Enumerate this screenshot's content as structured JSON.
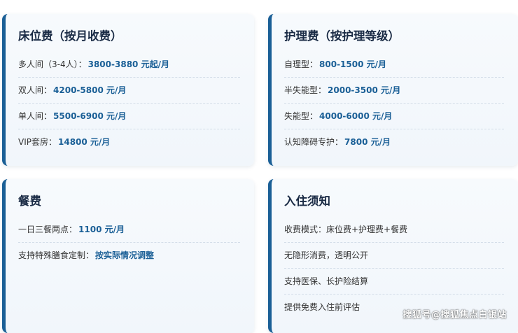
{
  "colors": {
    "accent": "#1a5f96",
    "title": "#1a2b45",
    "text": "#333333",
    "card_bg": "#f4f8fc"
  },
  "cards": [
    {
      "title": "床位费（按月收费）",
      "rows": [
        {
          "label": "多人间（3-4人）：",
          "value": "3800-3880 元起/月"
        },
        {
          "label": "双人间：",
          "value": "4200-5800 元/月"
        },
        {
          "label": "单人间：",
          "value": "5500-6900 元/月"
        },
        {
          "label": "VIP套房：",
          "value": "14800 元/月"
        }
      ]
    },
    {
      "title": "护理费（按护理等级）",
      "rows": [
        {
          "label": "自理型：",
          "value": "800-1500 元/月"
        },
        {
          "label": "半失能型：",
          "value": "2000-3500 元/月"
        },
        {
          "label": "失能型：",
          "value": "4000-6000 元/月"
        },
        {
          "label": "认知障碍专护：",
          "value": "7800 元/月"
        }
      ]
    },
    {
      "title": "餐费",
      "rows": [
        {
          "label": "一日三餐两点：",
          "value": "1100 元/月"
        },
        {
          "label": "支持特殊膳食定制：",
          "value": "按实际情况调整"
        }
      ]
    },
    {
      "title": "入住须知",
      "rows": [
        {
          "label": "收费模式：床位费+护理费+餐费",
          "value": ""
        },
        {
          "label": "无隐形消费，透明公开",
          "value": ""
        },
        {
          "label": "支持医保、长护险结算",
          "value": ""
        },
        {
          "label": "提供免费入住前评估",
          "value": ""
        }
      ]
    }
  ],
  "watermark": "搜狐号@搜狐焦点白银站"
}
